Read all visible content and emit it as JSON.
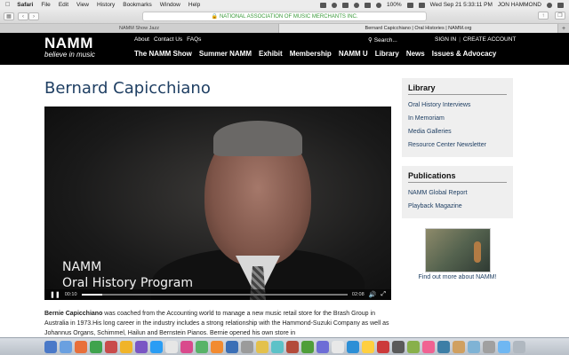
{
  "menubar": {
    "app_name": "Safari",
    "items": [
      "File",
      "Edit",
      "View",
      "History",
      "Bookmarks",
      "Window",
      "Help"
    ],
    "battery": "100%",
    "datetime": "Wed Sep 21  5:33:11 PM",
    "user": "JON HAMMOND"
  },
  "browser": {
    "url": "NATIONAL ASSOCIATION OF MUSIC MERCHANTS INC.",
    "tabs": [
      {
        "label": "NAMM Show Jazz",
        "active": false
      },
      {
        "label": "Bernard Capicchiano | Oral Histories | NAMM.org",
        "active": true
      }
    ]
  },
  "header": {
    "logo_word": "NAMM",
    "logo_tagline": "believe in music",
    "top_links": [
      "About",
      "Contact Us",
      "FAQs"
    ],
    "search_label": "Search...",
    "sign_in": "SIGN IN",
    "create_account": "CREATE ACCOUNT",
    "nav": [
      "The NAMM Show",
      "Summer NAMM",
      "Exhibit",
      "Membership",
      "NAMM U",
      "Library",
      "News",
      "Issues & Advocacy"
    ]
  },
  "main": {
    "title": "Bernard Capicchiano",
    "video": {
      "overlay_line1": "NAMM",
      "overlay_line2": "Oral History Program",
      "current_time": "00:10",
      "duration": "02:08",
      "progress": 0.08
    },
    "bio_name": "Bernie Capicchiano",
    "bio_text": " was coached from the Accounting world to manage a new music retail store for the Brash Group in Australia in 1973.His long career in the industry includes a strong relationship with the Hammond-Suzuki Company as well as Johannus Organs, Schimmel, Hailun and Bernstein Pianos. Bernie opened his own store in"
  },
  "sidebar": {
    "library": {
      "heading": "Library",
      "links": [
        "Oral History Interviews",
        "In Memoriam",
        "Media Galleries",
        "Resource Center Newsletter"
      ]
    },
    "publications": {
      "heading": "Publications",
      "links": [
        "NAMM Global Report",
        "Playback Magazine"
      ]
    },
    "promo_caption": "Find out more about NAMM!"
  },
  "dock": {
    "icon_colors": [
      "#4a79c8",
      "#6aa0e0",
      "#e86f3a",
      "#3fa34d",
      "#c94b4b",
      "#f0b429",
      "#7a56c4",
      "#2a9df4",
      "#e6e6e6",
      "#d94a8c",
      "#58b368",
      "#f28b30",
      "#3b6fb6",
      "#9b9b9b",
      "#e3c14d",
      "#5cc2c8",
      "#b34b3a",
      "#4f9e3a",
      "#6d6dd6",
      "#e8e8e8",
      "#2c8fd6",
      "#ffcf40",
      "#cc3a3a",
      "#5a5a5a",
      "#88b04b",
      "#f06292",
      "#3d7ea6",
      "#d0a060",
      "#7fb3d5",
      "#a0a0a0",
      "#6fb7f2",
      "#b0b8c0"
    ]
  }
}
